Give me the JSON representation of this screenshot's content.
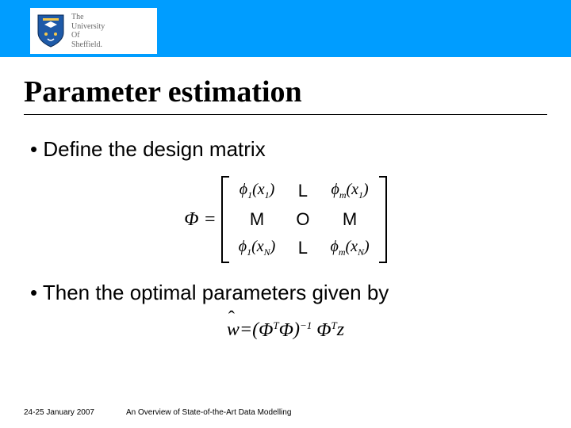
{
  "logo": {
    "line1": "The",
    "line2": "University",
    "line3": "Of",
    "line4": "Sheffield."
  },
  "title": "Parameter estimation",
  "bullets": {
    "b1": "Define the design matrix",
    "b2": "Then the optimal parameters given by"
  },
  "matrix": {
    "lhs": "Φ =",
    "cells": {
      "r1c1_a": "ϕ",
      "r1c1_sub": "1",
      "r1c1_b": "(x",
      "r1c1_sub2": "1",
      "r1c1_c": ")",
      "r1c2": "L",
      "r1c3_a": "ϕ",
      "r1c3_sub": "m",
      "r1c3_b": "(x",
      "r1c3_sub2": "1",
      "r1c3_c": ")",
      "r2c1": "M",
      "r2c2": "O",
      "r2c3": "M",
      "r3c1_a": "ϕ",
      "r3c1_sub": "1",
      "r3c1_b": "(x",
      "r3c1_sub2": "N",
      "r3c1_c": ")",
      "r3c2": "L",
      "r3c3_a": "ϕ",
      "r3c3_sub": "m",
      "r3c3_b": "(x",
      "r3c3_sub2": "N",
      "r3c3_c": ")"
    }
  },
  "equation": {
    "w": "w",
    "eq": " = ",
    "open": "(",
    "phiT1a": "Φ",
    "T1": "T",
    "phi1b": "Φ",
    "close": ")",
    "inv": "−1",
    "phiT2a": "Φ",
    "T2": "T",
    "z": "z"
  },
  "footer": {
    "date": "24-25 January 2007",
    "talk": "An Overview of State-of-the-Art Data Modelling"
  }
}
